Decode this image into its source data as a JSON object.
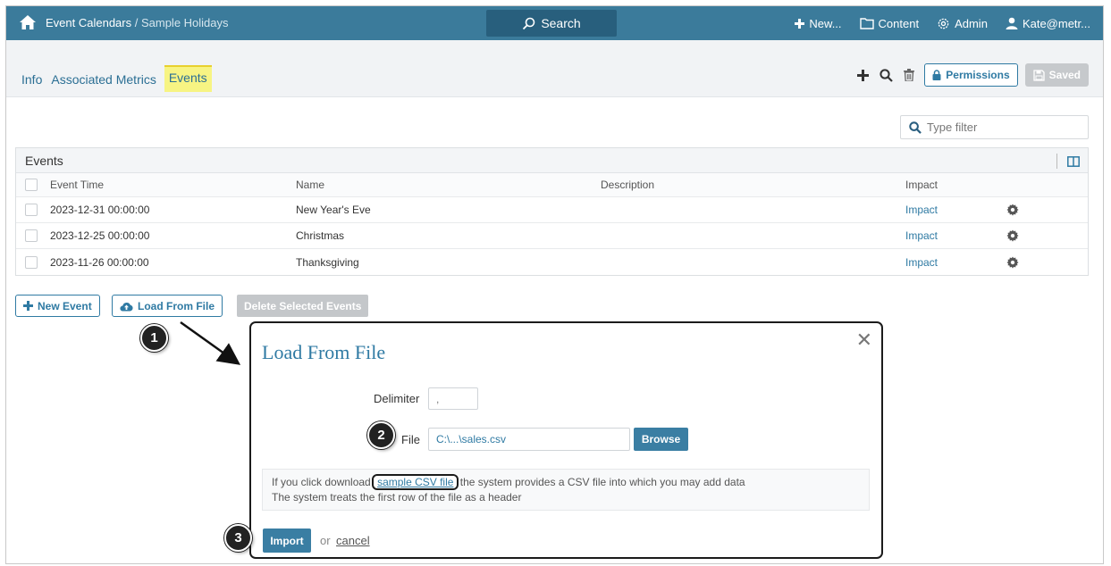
{
  "header": {
    "app_title": "Event Calendars",
    "separator": " / ",
    "page_title": "Sample Holidays",
    "search_label": "Search",
    "nav": {
      "new_label": "New...",
      "content_label": "Content",
      "admin_label": "Admin",
      "user_label": "Kate@metr..."
    }
  },
  "tabs": [
    {
      "label": "Info",
      "active": false
    },
    {
      "label": "Associated Metrics",
      "active": false
    },
    {
      "label": "Events",
      "active": true
    }
  ],
  "toolbar": {
    "permissions_label": "Permissions",
    "saved_label": "Saved"
  },
  "filter": {
    "placeholder": "Type filter"
  },
  "grid": {
    "title": "Events",
    "columns": [
      "Event Time",
      "Name",
      "Description",
      "Impact"
    ],
    "rows": [
      {
        "time": "2023-12-31 00:00:00",
        "name": "New Year's Eve",
        "description": "",
        "impact": "Impact"
      },
      {
        "time": "2023-12-25 00:00:00",
        "name": "Christmas",
        "description": "",
        "impact": "Impact"
      },
      {
        "time": "2023-11-26 00:00:00",
        "name": "Thanksgiving",
        "description": "",
        "impact": "Impact"
      }
    ]
  },
  "actions": {
    "new_event_label": "New Event",
    "load_from_file_label": "Load From File",
    "delete_selected_label": "Delete Selected Events"
  },
  "modal": {
    "title": "Load From File",
    "delimiter_label": "Delimiter",
    "delimiter_value": ",",
    "file_label": "File",
    "file_value": "C:\\...\\sales.csv",
    "browse_label": "Browse",
    "info_prefix": "If you click download ",
    "info_link": "sample CSV file",
    "info_suffix": " the system provides a CSV file into which you may add data",
    "info_line2": "The system treats the first row of the file as a header",
    "import_label": "Import",
    "or_label": "or",
    "cancel_label": "cancel"
  },
  "callouts": [
    "1",
    "2",
    "3"
  ],
  "colors": {
    "topbar": "#3b7b9b",
    "accent": "#2f7aa3",
    "active_tab": "#f7f483"
  }
}
